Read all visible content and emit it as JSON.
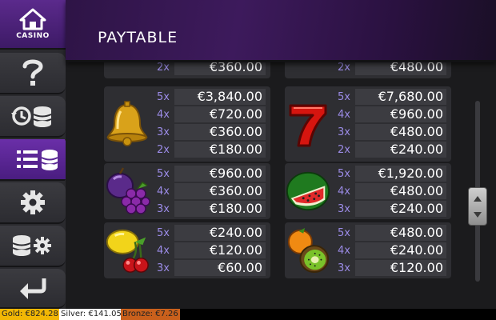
{
  "home": {
    "label": "CASINO"
  },
  "header": {
    "title": "PAYTABLE"
  },
  "sidebar": {
    "items": [
      {
        "icon": "help-icon"
      },
      {
        "icon": "history-icon"
      },
      {
        "icon": "paytable-icon",
        "active": true
      },
      {
        "icon": "settings-icon"
      },
      {
        "icon": "coin-settings-icon"
      },
      {
        "icon": "back-icon"
      }
    ]
  },
  "paytable": {
    "top_partial": [
      {
        "mult": "2x",
        "payout": "€360.00"
      },
      {
        "mult": "2x",
        "payout": "€480.00"
      }
    ],
    "bell": [
      {
        "mult": "5x",
        "payout": "€3,840.00"
      },
      {
        "mult": "4x",
        "payout": "€720.00"
      },
      {
        "mult": "3x",
        "payout": "€360.00"
      },
      {
        "mult": "2x",
        "payout": "€180.00"
      }
    ],
    "seven": [
      {
        "mult": "5x",
        "payout": "€7,680.00"
      },
      {
        "mult": "4x",
        "payout": "€960.00"
      },
      {
        "mult": "3x",
        "payout": "€480.00"
      },
      {
        "mult": "2x",
        "payout": "€240.00"
      }
    ],
    "plum_grapes": [
      {
        "mult": "5x",
        "payout": "€960.00"
      },
      {
        "mult": "4x",
        "payout": "€360.00"
      },
      {
        "mult": "3x",
        "payout": "€180.00"
      }
    ],
    "watermelon": [
      {
        "mult": "5x",
        "payout": "€1,920.00"
      },
      {
        "mult": "4x",
        "payout": "€480.00"
      },
      {
        "mult": "3x",
        "payout": "€240.00"
      }
    ],
    "lemon_cherry": [
      {
        "mult": "5x",
        "payout": "€240.00"
      },
      {
        "mult": "4x",
        "payout": "€120.00"
      },
      {
        "mult": "3x",
        "payout": "€60.00"
      }
    ],
    "orange_kiwi": [
      {
        "mult": "5x",
        "payout": "€480.00"
      },
      {
        "mult": "4x",
        "payout": "€240.00"
      },
      {
        "mult": "3x",
        "payout": "€120.00"
      }
    ]
  },
  "status": {
    "gold": "Gold: €824.28",
    "silver": "Silver: €141.05",
    "bronze": "Bronze: €7.26"
  },
  "colors": {
    "accent": "#5b2a8c",
    "multiplier": "#9b8be6",
    "gold": "#f2b705",
    "bronze": "#c9601c"
  }
}
